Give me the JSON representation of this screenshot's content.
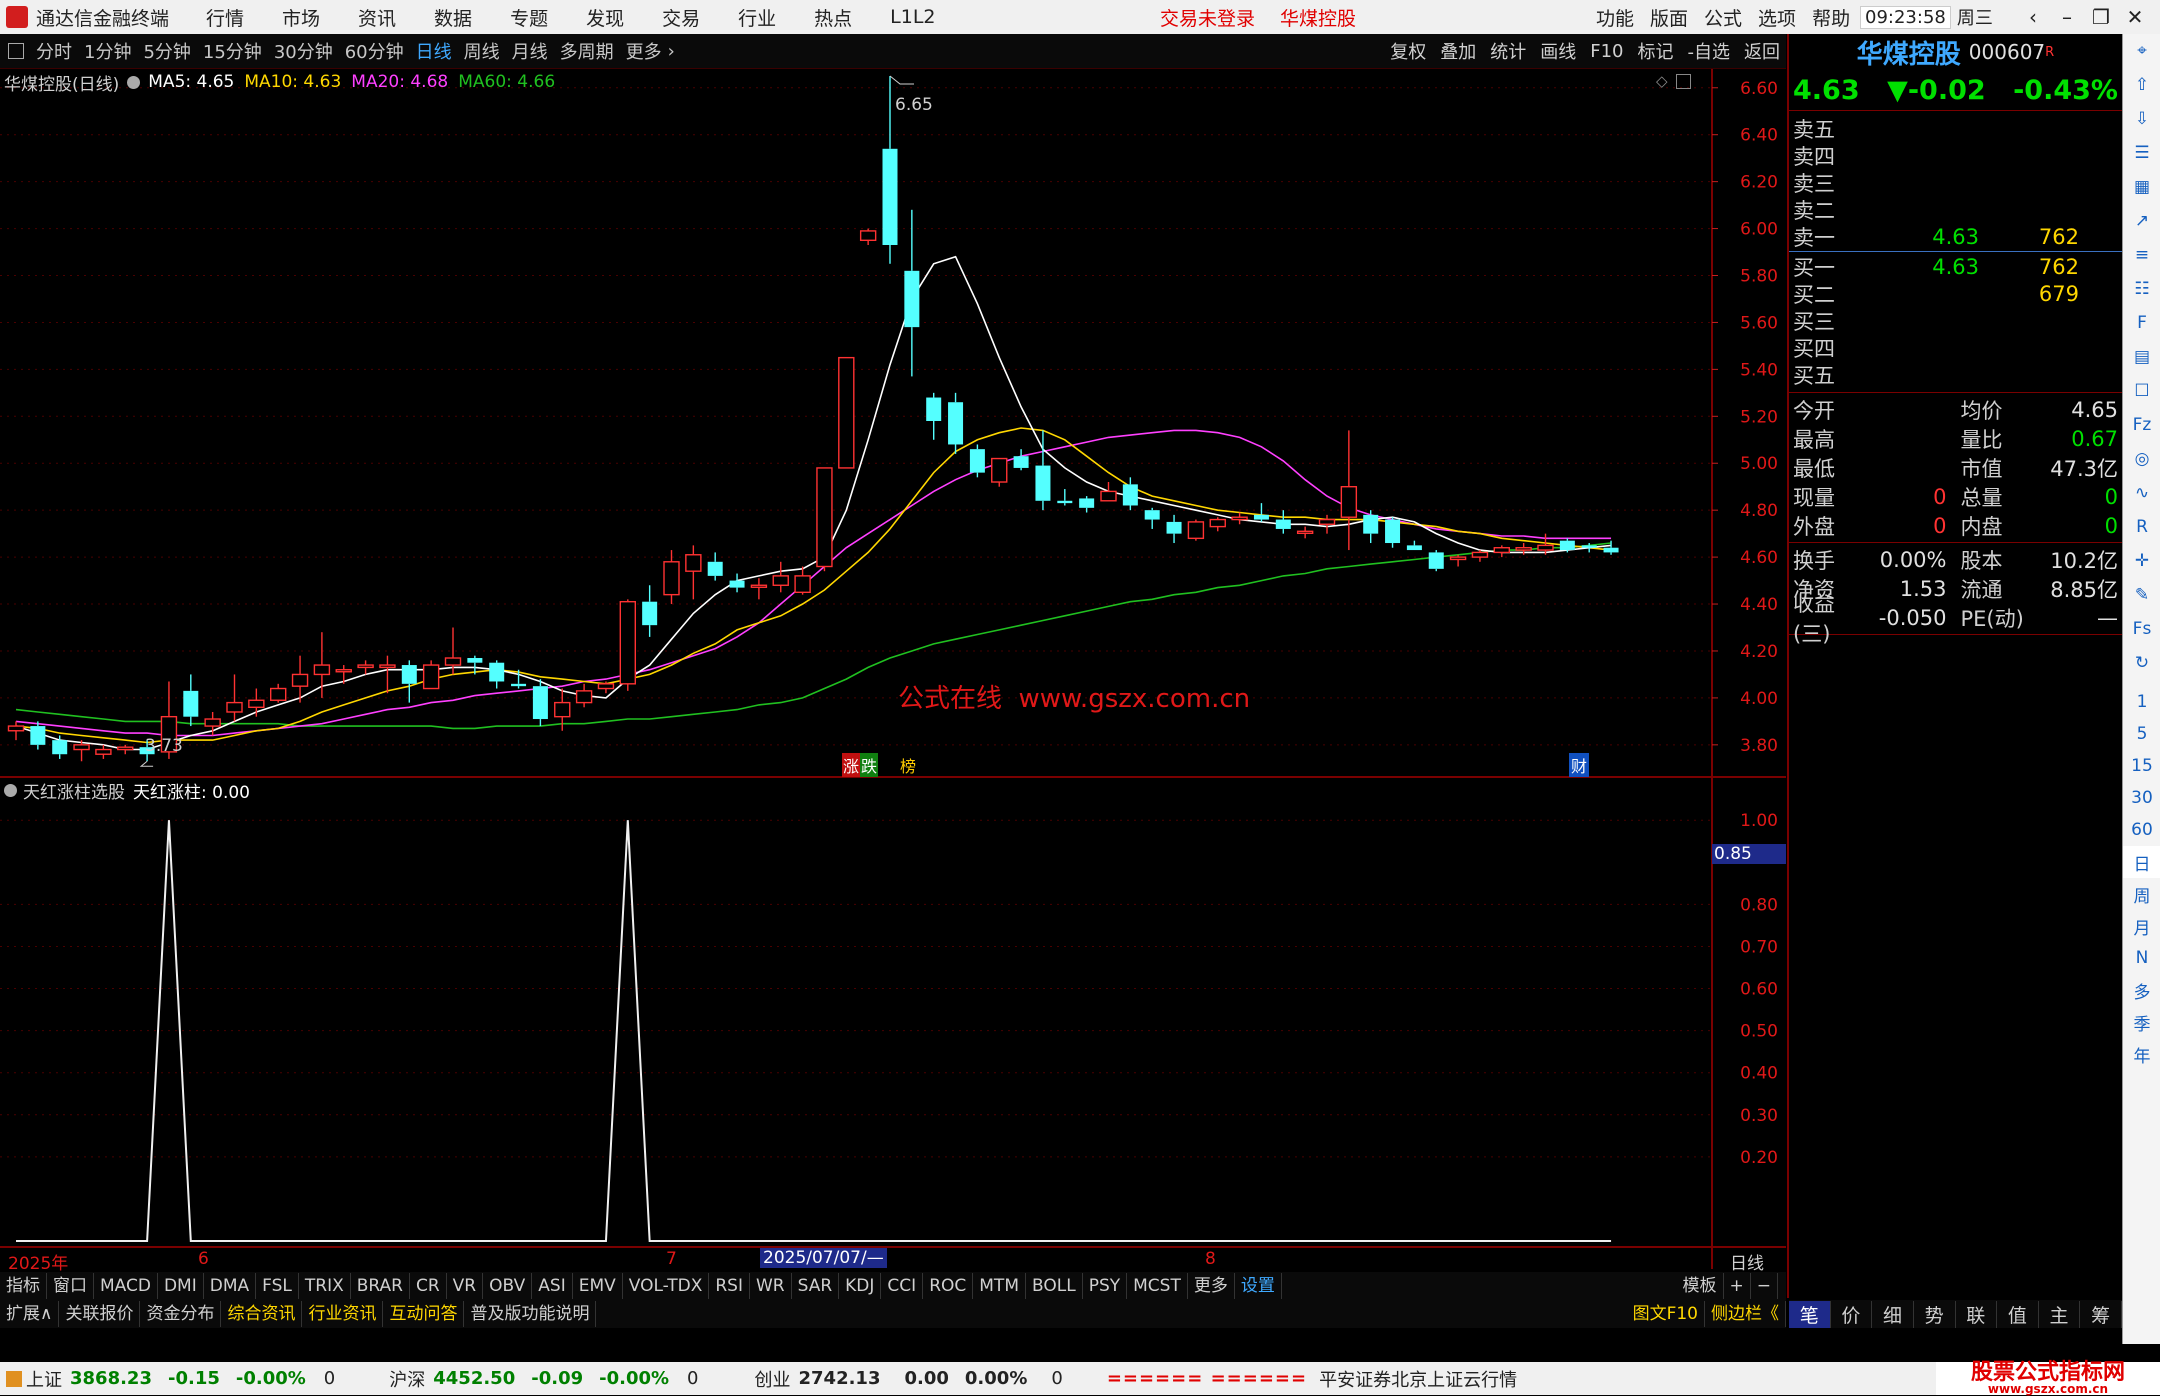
{
  "app": {
    "name": "通达信金融终端",
    "time": "09:23:58",
    "weekday": "周三"
  },
  "title_menu": [
    "行情",
    "市场",
    "资讯",
    "数据",
    "专题",
    "发现",
    "交易",
    "行业",
    "热点",
    "L1L2"
  ],
  "login_status": "交易未登录",
  "stock_name_title": "华煤控股",
  "right_menu": [
    "功能",
    "版面",
    "公式",
    "选项",
    "帮助"
  ],
  "periods": [
    "分时",
    "1分钟",
    "5分钟",
    "15分钟",
    "30分钟",
    "60分钟",
    "日线",
    "周线",
    "月线",
    "多周期",
    "更多"
  ],
  "active_period": "日线",
  "toolbar_right": [
    "复权",
    "叠加",
    "统计",
    "画线",
    "F10",
    "标记",
    "-自选",
    "返回"
  ],
  "chart_header": {
    "name": "华煤控股(日线)",
    "ma5": "MA5: 4.65",
    "ma10": "MA10: 4.63",
    "ma20": "MA20: 4.68",
    "ma60": "MA60: 4.66"
  },
  "colors": {
    "up": "#ff3232",
    "down": "#54ffff",
    "ma5": "#ffffff",
    "ma10": "#ffd700",
    "ma20": "#ff40ff",
    "ma60": "#20c020",
    "axis": "#c81e1e",
    "blue": "#3fa9ff",
    "accent_green": "#00e000"
  },
  "price_axis": [
    "6.60",
    "6.40",
    "6.20",
    "6.00",
    "5.80",
    "5.60",
    "5.40",
    "5.20",
    "5.00",
    "4.80",
    "4.60",
    "4.40",
    "4.20",
    "4.00",
    "3.80"
  ],
  "annotations": {
    "high": "6.65",
    "low": "3.73",
    "watermark": "公式在线  www.gszx.com.cn",
    "tag_zhang": "涨",
    "tag_die": "跌",
    "tag_bang": "榜",
    "tag_cai": "财"
  },
  "indicator": {
    "title": "天红涨柱选股",
    "value_label": "天红涨柱: 0.00",
    "axis": [
      "1.00",
      "0.80",
      "0.70",
      "0.60",
      "0.50",
      "0.40",
      "0.30",
      "0.20"
    ],
    "cursor_value": "0.85"
  },
  "date_axis": {
    "y2025": "2025年",
    "m6": "6",
    "m7": "7",
    "cursor": "2025/07/07/—",
    "m8": "8",
    "period": "日线"
  },
  "chart_data": [
    {
      "type": "candlestick",
      "title": "华煤控股(日线)",
      "ylim": [
        3.68,
        6.68
      ],
      "candles": [
        [
          3.86,
          3.9,
          3.82,
          3.88
        ],
        [
          3.88,
          3.9,
          3.78,
          3.8
        ],
        [
          3.82,
          3.84,
          3.74,
          3.76
        ],
        [
          3.78,
          3.82,
          3.73,
          3.8
        ],
        [
          3.76,
          3.8,
          3.74,
          3.78
        ],
        [
          3.78,
          3.8,
          3.76,
          3.79
        ],
        [
          3.79,
          3.82,
          3.73,
          3.76
        ],
        [
          3.77,
          4.07,
          3.74,
          3.92
        ],
        [
          4.03,
          4.1,
          3.88,
          3.92
        ],
        [
          3.88,
          3.94,
          3.84,
          3.91
        ],
        [
          3.94,
          4.1,
          3.9,
          3.98
        ],
        [
          3.96,
          4.04,
          3.92,
          3.99
        ],
        [
          3.99,
          4.06,
          3.98,
          4.04
        ],
        [
          4.05,
          4.18,
          3.98,
          4.1
        ],
        [
          4.1,
          4.28,
          4.0,
          4.14
        ],
        [
          4.12,
          4.14,
          4.06,
          4.12
        ],
        [
          4.13,
          4.16,
          4.1,
          4.14
        ],
        [
          4.13,
          4.18,
          4.02,
          4.14
        ],
        [
          4.14,
          4.16,
          3.98,
          4.06
        ],
        [
          4.04,
          4.16,
          4.04,
          4.14
        ],
        [
          4.14,
          4.3,
          4.1,
          4.17
        ],
        [
          4.17,
          4.18,
          4.1,
          4.15
        ],
        [
          4.15,
          4.16,
          4.04,
          4.07
        ],
        [
          4.06,
          4.12,
          4.04,
          4.05
        ],
        [
          4.05,
          4.08,
          3.88,
          3.91
        ],
        [
          3.92,
          4.04,
          3.86,
          3.98
        ],
        [
          3.98,
          4.06,
          3.96,
          4.03
        ],
        [
          4.04,
          4.07,
          4.02,
          4.06
        ],
        [
          4.06,
          4.42,
          4.03,
          4.41
        ],
        [
          4.41,
          4.48,
          4.26,
          4.31
        ],
        [
          4.44,
          4.63,
          4.4,
          4.58
        ],
        [
          4.54,
          4.65,
          4.42,
          4.61
        ],
        [
          4.58,
          4.62,
          4.5,
          4.52
        ],
        [
          4.5,
          4.53,
          4.45,
          4.47
        ],
        [
          4.48,
          4.51,
          4.42,
          4.48
        ],
        [
          4.48,
          4.58,
          4.45,
          4.52
        ],
        [
          4.45,
          4.56,
          4.44,
          4.52
        ],
        [
          4.56,
          4.98,
          4.54,
          4.98
        ],
        [
          4.98,
          5.44,
          4.98,
          5.45
        ],
        [
          5.95,
          6.0,
          5.93,
          5.99
        ],
        [
          6.34,
          6.65,
          5.85,
          5.93
        ],
        [
          5.82,
          6.08,
          5.37,
          5.58
        ],
        [
          5.28,
          5.3,
          5.1,
          5.18
        ],
        [
          5.26,
          5.3,
          5.04,
          5.08
        ],
        [
          5.06,
          5.08,
          4.94,
          4.96
        ],
        [
          4.92,
          5.02,
          4.9,
          5.02
        ],
        [
          5.03,
          5.06,
          4.97,
          4.98
        ],
        [
          4.99,
          5.14,
          4.8,
          4.84
        ],
        [
          4.84,
          4.89,
          4.82,
          4.83
        ],
        [
          4.85,
          4.86,
          4.79,
          4.81
        ],
        [
          4.84,
          4.92,
          4.84,
          4.88
        ],
        [
          4.91,
          4.94,
          4.8,
          4.82
        ],
        [
          4.8,
          4.81,
          4.72,
          4.76
        ],
        [
          4.75,
          4.78,
          4.66,
          4.7
        ],
        [
          4.68,
          4.76,
          4.67,
          4.75
        ],
        [
          4.73,
          4.77,
          4.71,
          4.76
        ],
        [
          4.76,
          4.79,
          4.74,
          4.77
        ],
        [
          4.78,
          4.83,
          4.75,
          4.76
        ],
        [
          4.76,
          4.8,
          4.7,
          4.72
        ],
        [
          4.71,
          4.73,
          4.68,
          4.71
        ],
        [
          4.74,
          4.78,
          4.7,
          4.76
        ],
        [
          4.77,
          5.14,
          4.63,
          4.9
        ],
        [
          4.78,
          4.8,
          4.66,
          4.7
        ],
        [
          4.76,
          4.77,
          4.64,
          4.66
        ],
        [
          4.65,
          4.67,
          4.63,
          4.63
        ],
        [
          4.62,
          4.63,
          4.54,
          4.55
        ],
        [
          4.59,
          4.61,
          4.56,
          4.6
        ],
        [
          4.6,
          4.63,
          4.58,
          4.62
        ],
        [
          4.62,
          4.65,
          4.6,
          4.64
        ],
        [
          4.63,
          4.66,
          4.61,
          4.64
        ],
        [
          4.63,
          4.7,
          4.61,
          4.65
        ],
        [
          4.67,
          4.68,
          4.62,
          4.63
        ],
        [
          4.65,
          4.66,
          4.62,
          4.64
        ],
        [
          4.64,
          4.67,
          4.61,
          4.62
        ]
      ],
      "ma5": [
        3.88,
        3.85,
        3.82,
        3.81,
        3.8,
        3.78,
        3.78,
        3.81,
        3.84,
        3.86,
        3.9,
        3.94,
        3.97,
        4.0,
        4.05,
        4.07,
        4.1,
        4.12,
        4.12,
        4.12,
        4.13,
        4.13,
        4.12,
        4.1,
        4.07,
        4.03,
        4.01,
        4.0,
        4.08,
        4.14,
        4.25,
        4.36,
        4.44,
        4.5,
        4.52,
        4.54,
        4.55,
        4.6,
        4.8,
        5.1,
        5.42,
        5.7,
        5.85,
        5.88,
        5.68,
        5.45,
        5.24,
        5.06,
        4.98,
        4.92,
        4.88,
        4.86,
        4.84,
        4.82,
        4.8,
        4.78,
        4.76,
        4.75,
        4.74,
        4.74,
        4.73,
        4.74,
        4.76,
        4.77,
        4.75,
        4.7,
        4.66,
        4.63,
        4.62,
        4.62,
        4.62,
        4.63,
        4.64,
        4.65
      ],
      "ma10": [
        3.88,
        3.87,
        3.85,
        3.84,
        3.83,
        3.82,
        3.81,
        3.82,
        3.82,
        3.82,
        3.84,
        3.86,
        3.87,
        3.9,
        3.94,
        3.97,
        4.0,
        4.03,
        4.05,
        4.08,
        4.1,
        4.11,
        4.12,
        4.11,
        4.09,
        4.08,
        4.07,
        4.06,
        4.08,
        4.1,
        4.14,
        4.19,
        4.23,
        4.29,
        4.32,
        4.35,
        4.4,
        4.46,
        4.54,
        4.62,
        4.72,
        4.84,
        4.96,
        5.05,
        5.1,
        5.13,
        5.15,
        5.14,
        5.1,
        5.03,
        4.96,
        4.9,
        4.86,
        4.84,
        4.82,
        4.8,
        4.79,
        4.78,
        4.77,
        4.77,
        4.76,
        4.76,
        4.76,
        4.75,
        4.74,
        4.73,
        4.71,
        4.7,
        4.68,
        4.67,
        4.66,
        4.65,
        4.64,
        4.63
      ],
      "ma20": [
        3.9,
        3.89,
        3.88,
        3.87,
        3.86,
        3.85,
        3.85,
        3.84,
        3.84,
        3.84,
        3.85,
        3.86,
        3.87,
        3.88,
        3.89,
        3.91,
        3.93,
        3.95,
        3.96,
        3.98,
        3.99,
        4.01,
        4.02,
        4.03,
        4.04,
        4.05,
        4.07,
        4.08,
        4.1,
        4.12,
        4.15,
        4.18,
        4.21,
        4.26,
        4.32,
        4.4,
        4.48,
        4.56,
        4.64,
        4.7,
        4.76,
        4.82,
        4.88,
        4.93,
        4.97,
        5.0,
        5.03,
        5.05,
        5.07,
        5.09,
        5.11,
        5.12,
        5.13,
        5.14,
        5.14,
        5.13,
        5.11,
        5.07,
        5.01,
        4.93,
        4.86,
        4.81,
        4.78,
        4.76,
        4.74,
        4.72,
        4.71,
        4.7,
        4.69,
        4.69,
        4.68,
        4.68,
        4.68,
        4.68
      ],
      "ma60": [
        3.95,
        3.94,
        3.93,
        3.92,
        3.91,
        3.9,
        3.9,
        3.9,
        3.89,
        3.89,
        3.89,
        3.89,
        3.89,
        3.88,
        3.88,
        3.88,
        3.88,
        3.88,
        3.88,
        3.88,
        3.87,
        3.87,
        3.88,
        3.88,
        3.88,
        3.89,
        3.89,
        3.9,
        3.91,
        3.91,
        3.92,
        3.93,
        3.94,
        3.95,
        3.97,
        3.98,
        4.0,
        4.04,
        4.08,
        4.13,
        4.17,
        4.2,
        4.23,
        4.25,
        4.27,
        4.29,
        4.31,
        4.33,
        4.35,
        4.37,
        4.39,
        4.41,
        4.42,
        4.44,
        4.45,
        4.47,
        4.48,
        4.5,
        4.52,
        4.53,
        4.55,
        4.56,
        4.57,
        4.58,
        4.59,
        4.6,
        4.61,
        4.62,
        4.63,
        4.63,
        4.64,
        4.64,
        4.65,
        4.66
      ]
    },
    {
      "type": "line",
      "title": "天红涨柱选股",
      "ylim": [
        0,
        1.06
      ],
      "values": [
        0,
        0,
        0,
        0,
        0,
        0,
        0,
        1,
        0,
        0,
        0,
        0,
        0,
        0,
        0,
        0,
        0,
        0,
        0,
        0,
        0,
        0,
        0,
        0,
        0,
        0,
        0,
        0,
        1,
        0,
        0,
        0,
        0,
        0,
        0,
        0,
        0,
        0,
        0,
        0,
        0,
        0,
        0,
        0,
        0,
        0,
        0,
        0,
        0,
        0,
        0,
        0,
        0,
        0,
        0,
        0,
        0,
        0,
        0,
        0,
        0,
        0,
        0,
        0,
        0,
        0,
        0,
        0,
        0,
        0,
        0,
        0,
        0,
        0
      ]
    }
  ],
  "indicator_tabs": [
    "指标",
    "窗口",
    "MACD",
    "DMI",
    "DMA",
    "FSL",
    "TRIX",
    "BRAR",
    "CR",
    "VR",
    "OBV",
    "ASI",
    "EMV",
    "VOL-TDX",
    "RSI",
    "WR",
    "SAR",
    "KDJ",
    "CCI",
    "ROC",
    "MTM",
    "BOLL",
    "PSY",
    "MCST",
    "更多",
    "设置"
  ],
  "indicator_tabs_right": [
    "模板",
    "+",
    "−"
  ],
  "info_tabs": [
    "扩展∧",
    "关联报价",
    "资金分布",
    "综合资讯",
    "行业资讯",
    "互动问答",
    "普及版功能说明"
  ],
  "info_tabs_right": [
    "图文F10",
    "侧边栏《"
  ],
  "panel_tabs": [
    "笔",
    "价",
    "细",
    "势",
    "联",
    "值",
    "主",
    "筹"
  ],
  "quote": {
    "name": "华煤控股",
    "code": "000607",
    "badge": "R",
    "price": "4.63",
    "change": "▼-0.02",
    "pct": "-0.43%",
    "sell": [
      {
        "label": "卖五",
        "price": "",
        "vol": ""
      },
      {
        "label": "卖四",
        "price": "",
        "vol": ""
      },
      {
        "label": "卖三",
        "price": "",
        "vol": ""
      },
      {
        "label": "卖二",
        "price": "",
        "vol": ""
      },
      {
        "label": "卖一",
        "price": "4.63",
        "vol": "762"
      }
    ],
    "buy": [
      {
        "label": "买一",
        "price": "4.63",
        "vol": "762"
      },
      {
        "label": "买二",
        "price": "",
        "vol": "679"
      },
      {
        "label": "买三",
        "price": "",
        "vol": ""
      },
      {
        "label": "买四",
        "price": "",
        "vol": ""
      },
      {
        "label": "买五",
        "price": "",
        "vol": ""
      }
    ],
    "stats1": [
      {
        "l": "今开",
        "v": "",
        "l2": "均价",
        "v2": "4.65"
      },
      {
        "l": "最高",
        "v": "",
        "l2": "量比",
        "v2": "0.67"
      },
      {
        "l": "最低",
        "v": "",
        "l2": "市值",
        "v2": "47.3亿"
      },
      {
        "l": "现量",
        "v": "0",
        "l2": "总量",
        "v2": "0"
      },
      {
        "l": "外盘",
        "v": "0",
        "l2": "内盘",
        "v2": "0"
      }
    ],
    "stats2": [
      {
        "l": "换手",
        "v": "0.00%",
        "l2": "股本",
        "v2": "10.2亿"
      },
      {
        "l": "净资",
        "v": "1.53",
        "l2": "流通",
        "v2": "8.85亿"
      },
      {
        "l": "收益(三)",
        "v": "-0.050",
        "l2": "PE(动)",
        "v2": "—"
      }
    ]
  },
  "side_icons": [
    "pin-icon",
    "up-arrow-icon",
    "down-arrow-icon",
    "list-icon",
    "grid-icon",
    "line-chart-icon",
    "candle-icon",
    "news-icon",
    "fio-icon",
    "report-icon",
    "f10-icon",
    "fz-icon",
    "circle-icon",
    "wave-icon",
    "rsi-icon",
    "move-icon",
    "pen-icon",
    "fs-icon",
    "refresh-icon"
  ],
  "side_labels": [
    "1",
    "5",
    "15",
    "30",
    "60",
    "日",
    "周",
    "月",
    "N",
    "多",
    "季",
    "年"
  ],
  "status": {
    "sh_name": "上证",
    "sh_val": "3868.23",
    "sh_chg": "-0.15",
    "sh_pct": "-0.00%",
    "sh_vol": "0",
    "sz_name": "沪深",
    "sz_val": "4452.50",
    "sz_chg": "-0.09",
    "sz_pct": "-0.00%",
    "sz_vol": "0",
    "cy_name": "创业",
    "cy_val": "2742.13",
    "cy_chg": "0.00",
    "cy_pct": "0.00%",
    "cy_vol": "0",
    "ticker": "====== ======",
    "server": "平安证券北京上证云行情",
    "brand": "股票公式指标网",
    "brand_url": "www.gszx.com.cn"
  }
}
